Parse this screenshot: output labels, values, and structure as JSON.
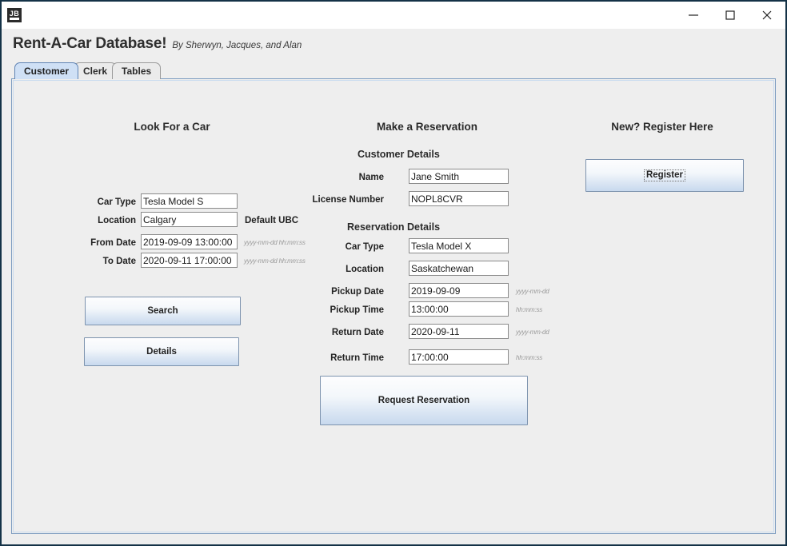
{
  "window": {
    "icon_name": "jb-app-icon",
    "controls": [
      {
        "name": "minimize-button",
        "label": "—"
      },
      {
        "name": "maximize-button",
        "label": "□"
      },
      {
        "name": "close-button",
        "label": "✕"
      }
    ]
  },
  "header": {
    "title": "Rent-A-Car Database!",
    "byline": "By Sherwyn, Jacques, and Alan"
  },
  "tabs": [
    {
      "label": "Customer",
      "selected": true
    },
    {
      "label": "Clerk",
      "selected": false
    },
    {
      "label": "Tables",
      "selected": false
    }
  ],
  "search_panel": {
    "title": "Look For a Car",
    "fields": [
      {
        "label": "Car Type",
        "value": "Tesla Model S",
        "hint": ""
      },
      {
        "label": "Location",
        "value": "Calgary",
        "hint": ""
      },
      {
        "label": "From Date",
        "value": "2019-09-09 13:00:00",
        "hint": "yyyy-mm-dd hh:mm:ss"
      },
      {
        "label": "To Date",
        "value": "2020-09-11 17:00:00",
        "hint": "yyyy-mm-dd hh:mm:ss"
      }
    ],
    "default_location_label": "Default UBC",
    "search_button": "Search",
    "details_button": "Details"
  },
  "reservation_panel": {
    "title": "Make a Reservation",
    "customer_details_heading": "Customer Details",
    "customer_fields": [
      {
        "label": "Name",
        "value": "Jane Smith"
      },
      {
        "label": "License Number",
        "value": "NOPL8CVR"
      }
    ],
    "reservation_details_heading": "Reservation Details",
    "reservation_fields": [
      {
        "label": "Car Type",
        "value": "Tesla Model X",
        "hint": ""
      },
      {
        "label": "Location",
        "value": "Saskatchewan",
        "hint": ""
      },
      {
        "label": "Pickup Date",
        "value": "2019-09-09",
        "hint": "yyyy-mm-dd"
      },
      {
        "label": "Pickup Time",
        "value": "13:00:00",
        "hint": "hh:mm:ss"
      },
      {
        "label": "Return Date",
        "value": "2020-09-11",
        "hint": "yyyy-mm-dd"
      },
      {
        "label": "Return Time",
        "value": "17:00:00",
        "hint": "hh:mm:ss"
      }
    ],
    "request_button": "Request Reservation"
  },
  "register_panel": {
    "title": "New? Register Here",
    "register_button": "Register"
  },
  "colors": {
    "window_border": "#143247",
    "panel_background": "#eeeeee",
    "tab_selected": "#cfe0f5",
    "content_border": "#7d9cc0",
    "button_accent": "#c8d9ee"
  }
}
